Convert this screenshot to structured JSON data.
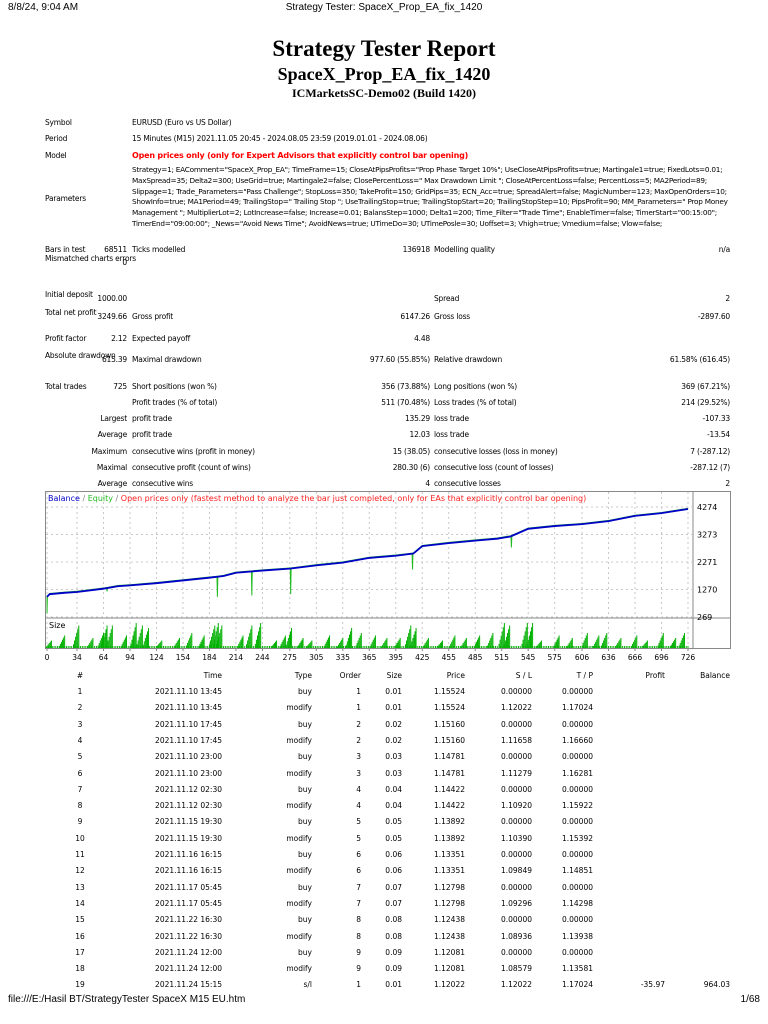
{
  "browser": {
    "datetime": "8/8/24, 9:04 AM",
    "tab_title": "Strategy Tester: SpaceX_Prop_EA_fix_1420",
    "file_path": "file:///E:/Hasil BT/StrategyTester SpaceX M15 EU.htm",
    "page": "1/68"
  },
  "report": {
    "title": "Strategy Tester Report",
    "ea_name": "SpaceX_Prop_EA_fix_1420",
    "server": "ICMarketsSC-Demo02 (Build 1420)"
  },
  "summary": {
    "symbol_label": "Symbol",
    "symbol": "EURUSD (Euro vs US Dollar)",
    "period_label": "Period",
    "period": "15 Minutes (M15) 2021.11.05 20:45 - 2024.08.05 23:59 (2019.01.01 - 2024.08.06)",
    "model_label": "Model",
    "model": "Open prices only (only for Expert Advisors that explicitly control bar opening)",
    "parameters_label": "Parameters",
    "parameters": "Strategy=1; EAComment=\"SpaceX_Prop_EA\"; TimeFrame=15; CloseAtPipsProfits=\"Prop Phase Target 10%\"; UseCloseAtPipsProfits=true; Martingale1=true; FixedLots=0.01; MaxSpread=35; Delta2=300; UseGrid=true; Martingale2=false; ClosePercentLoss=\" Max Drawdown Limit \"; CloseAtPercentLoss=false; PercentLoss=5; MA2Period=89; Slippage=1; Trade_Parameters=\"Pass Challenge\"; StopLoss=350; TakeProfit=150; GridPips=35; ECN_Acc=true; SpreadAlert=false; MagicNumber=123; MaxOpenOrders=10; ShowInfo=true; MA1Period=49; TrailingStop=\" Trailing Stop \"; UseTrailingStop=true; TrailingStopStart=20; TrailingStopStep=10; PipsProfit=90; MM_Parameters=\" Prop Money Management \"; MultiplierLot=2; LotIncrease=false; Increase=0.01; BalansStep=1000; Delta1=200; Time_Filter=\"Trade Time\"; EnableTimer=false; TimerStart=\"00:15:00\"; TimerEnd=\"09:00:00\"; _News=\"Avoid News Time\"; AvoidNews=true; UTimeDo=30; UTimePosle=30; Uoffset=3; Vhigh=true; Vmedium=false; Vlow=false;",
    "rows": [
      {
        "l1": "Bars in test",
        "v1": "68511",
        "l2": "Ticks modelled",
        "v2": "136918",
        "l3": "Modelling quality",
        "v3": "n/a"
      },
      {
        "l1": "Mismatched charts errors",
        "v1": "0",
        "l2": "",
        "v2": "",
        "l3": "",
        "v3": ""
      },
      {
        "l1": "Initial deposit",
        "v1": "1000.00",
        "l2": "",
        "v2": "",
        "l3": "Spread",
        "v3": "2"
      },
      {
        "l1": "Total net profit",
        "v1": "3249.66",
        "l2": "Gross profit",
        "v2": "6147.26",
        "l3": "Gross loss",
        "v3": "-2897.60"
      },
      {
        "l1": "Profit factor",
        "v1": "2.12",
        "l2": "Expected payoff",
        "v2": "4.48",
        "l3": "",
        "v3": ""
      },
      {
        "l1": "Absolute drawdown",
        "v1": "615.39",
        "l2": "Maximal drawdown",
        "v2": "977.60 (55.85%)",
        "l3": "Relative drawdown",
        "v3": "61.58% (616.45)"
      },
      {
        "l1": "Total trades",
        "v1": "725",
        "l2": "Short positions (won %)",
        "v2": "356 (73.88%)",
        "l3": "Long positions (won %)",
        "v3": "369 (67.21%)"
      },
      {
        "l1": "",
        "v1": "",
        "l2": "Profit trades (% of total)",
        "v2": "511 (70.48%)",
        "l3": "Loss trades (% of total)",
        "v3": "214 (29.52%)"
      },
      {
        "l1": "",
        "v1": "Largest",
        "l2": "profit trade",
        "v2": "135.29",
        "l3": "loss trade",
        "v3": "-107.33"
      },
      {
        "l1": "",
        "v1": "Average",
        "l2": "profit trade",
        "v2": "12.03",
        "l3": "loss trade",
        "v3": "-13.54"
      },
      {
        "l1": "",
        "v1": "Maximum",
        "l2": "consecutive wins (profit in money)",
        "v2": "15 (38.05)",
        "l3": "consecutive losses (loss in money)",
        "v3": "7 (-287.12)"
      },
      {
        "l1": "",
        "v1": "Maximal",
        "l2": "consecutive profit (count of wins)",
        "v2": "280.30 (6)",
        "l3": "consecutive loss (count of losses)",
        "v3": "-287.12 (7)"
      },
      {
        "l1": "",
        "v1": "Average",
        "l2": "consecutive wins",
        "v2": "4",
        "l3": "consecutive losses",
        "v3": "2"
      }
    ]
  },
  "chart_data": {
    "type": "line",
    "legend": {
      "balance": "Balance",
      "sep1": " / ",
      "equity": "Equity",
      "sep2": " / ",
      "model": "Open prices only (fastest method to analyze the bar just completed, only for EAs that explicitly control bar opening)"
    },
    "size_label": "Size",
    "colors": {
      "balance": "#0000c8",
      "equity": "#22bb22",
      "model": "#ff2020",
      "size": "#00b000",
      "grid": "#c8c8c8"
    },
    "x_ticks": [
      "0",
      "34",
      "64",
      "94",
      "124",
      "154",
      "184",
      "214",
      "244",
      "275",
      "305",
      "335",
      "365",
      "395",
      "425",
      "455",
      "485",
      "515",
      "545",
      "575",
      "606",
      "636",
      "666",
      "696",
      "726"
    ],
    "y_ticks": [
      "4274",
      "3273",
      "2271",
      "1270",
      "269"
    ],
    "xlim": [
      0,
      726
    ],
    "ylim": [
      269,
      4274
    ],
    "balance": [
      [
        0,
        1000
      ],
      [
        3,
        1100
      ],
      [
        20,
        1150
      ],
      [
        34,
        1180
      ],
      [
        64,
        1300
      ],
      [
        80,
        1390
      ],
      [
        94,
        1420
      ],
      [
        124,
        1500
      ],
      [
        154,
        1600
      ],
      [
        184,
        1700
      ],
      [
        200,
        1760
      ],
      [
        214,
        1880
      ],
      [
        244,
        1960
      ],
      [
        275,
        2030
      ],
      [
        305,
        2150
      ],
      [
        335,
        2250
      ],
      [
        365,
        2420
      ],
      [
        395,
        2500
      ],
      [
        415,
        2580
      ],
      [
        425,
        2850
      ],
      [
        455,
        2960
      ],
      [
        485,
        3050
      ],
      [
        510,
        3120
      ],
      [
        525,
        3200
      ],
      [
        545,
        3480
      ],
      [
        575,
        3580
      ],
      [
        606,
        3650
      ],
      [
        636,
        3760
      ],
      [
        666,
        3950
      ],
      [
        696,
        4050
      ],
      [
        726,
        4200
      ]
    ],
    "equity_dips": [
      [
        0,
        400
      ],
      [
        68,
        1200
      ],
      [
        193,
        1000
      ],
      [
        232,
        1050
      ],
      [
        276,
        1100
      ],
      [
        414,
        2000
      ],
      [
        526,
        2800
      ]
    ],
    "size_spikes": [
      [
        5,
        0.3
      ],
      [
        20,
        0.5
      ],
      [
        36,
        0.9
      ],
      [
        52,
        0.4
      ],
      [
        64,
        0.6
      ],
      [
        68,
        0.9
      ],
      [
        74,
        0.9
      ],
      [
        90,
        0.5
      ],
      [
        101,
        1
      ],
      [
        108,
        0.9
      ],
      [
        115,
        0.8
      ],
      [
        130,
        0.3
      ],
      [
        150,
        0.4
      ],
      [
        164,
        0.6
      ],
      [
        178,
        0.5
      ],
      [
        190,
        0.9
      ],
      [
        194,
        1
      ],
      [
        198,
        0.9
      ],
      [
        222,
        0.5
      ],
      [
        232,
        0.9
      ],
      [
        242,
        1
      ],
      [
        260,
        0.3
      ],
      [
        270,
        0.5
      ],
      [
        277,
        0.8
      ],
      [
        290,
        0.4
      ],
      [
        300,
        0.3
      ],
      [
        320,
        0.5
      ],
      [
        335,
        0.4
      ],
      [
        345,
        0.8
      ],
      [
        356,
        0.6
      ],
      [
        372,
        0.5
      ],
      [
        385,
        0.4
      ],
      [
        400,
        0.4
      ],
      [
        412,
        0.9
      ],
      [
        418,
        0.8
      ],
      [
        432,
        0.4
      ],
      [
        448,
        0.3
      ],
      [
        462,
        0.5
      ],
      [
        475,
        0.4
      ],
      [
        490,
        0.5
      ],
      [
        505,
        0.6
      ],
      [
        518,
        1
      ],
      [
        524,
        0.9
      ],
      [
        544,
        1
      ],
      [
        550,
        1
      ],
      [
        560,
        0.3
      ],
      [
        580,
        0.5
      ],
      [
        595,
        0.4
      ],
      [
        612,
        0.6
      ],
      [
        625,
        0.5
      ],
      [
        634,
        0.6
      ],
      [
        650,
        0.4
      ],
      [
        668,
        0.5
      ],
      [
        680,
        0.3
      ],
      [
        698,
        0.6
      ],
      [
        712,
        0.4
      ],
      [
        722,
        0.6
      ]
    ]
  },
  "trades": {
    "headers": [
      "#",
      "Time",
      "Type",
      "Order",
      "Size",
      "Price",
      "S / L",
      "T / P",
      "Profit",
      "Balance"
    ],
    "rows": [
      [
        "1",
        "2021.11.10 13:45",
        "buy",
        "1",
        "0.01",
        "1.15524",
        "0.00000",
        "0.00000",
        "",
        ""
      ],
      [
        "2",
        "2021.11.10 13:45",
        "modify",
        "1",
        "0.01",
        "1.15524",
        "1.12022",
        "1.17024",
        "",
        ""
      ],
      [
        "3",
        "2021.11.10 17:45",
        "buy",
        "2",
        "0.02",
        "1.15160",
        "0.00000",
        "0.00000",
        "",
        ""
      ],
      [
        "4",
        "2021.11.10 17:45",
        "modify",
        "2",
        "0.02",
        "1.15160",
        "1.11658",
        "1.16660",
        "",
        ""
      ],
      [
        "5",
        "2021.11.10 23:00",
        "buy",
        "3",
        "0.03",
        "1.14781",
        "0.00000",
        "0.00000",
        "",
        ""
      ],
      [
        "6",
        "2021.11.10 23:00",
        "modify",
        "3",
        "0.03",
        "1.14781",
        "1.11279",
        "1.16281",
        "",
        ""
      ],
      [
        "7",
        "2021.11.12 02:30",
        "buy",
        "4",
        "0.04",
        "1.14422",
        "0.00000",
        "0.00000",
        "",
        ""
      ],
      [
        "8",
        "2021.11.12 02:30",
        "modify",
        "4",
        "0.04",
        "1.14422",
        "1.10920",
        "1.15922",
        "",
        ""
      ],
      [
        "9",
        "2021.11.15 19:30",
        "buy",
        "5",
        "0.05",
        "1.13892",
        "0.00000",
        "0.00000",
        "",
        ""
      ],
      [
        "10",
        "2021.11.15 19:30",
        "modify",
        "5",
        "0.05",
        "1.13892",
        "1.10390",
        "1.15392",
        "",
        ""
      ],
      [
        "11",
        "2021.11.16 16:15",
        "buy",
        "6",
        "0.06",
        "1.13351",
        "0.00000",
        "0.00000",
        "",
        ""
      ],
      [
        "12",
        "2021.11.16 16:15",
        "modify",
        "6",
        "0.06",
        "1.13351",
        "1.09849",
        "1.14851",
        "",
        ""
      ],
      [
        "13",
        "2021.11.17 05:45",
        "buy",
        "7",
        "0.07",
        "1.12798",
        "0.00000",
        "0.00000",
        "",
        ""
      ],
      [
        "14",
        "2021.11.17 05:45",
        "modify",
        "7",
        "0.07",
        "1.12798",
        "1.09296",
        "1.14298",
        "",
        ""
      ],
      [
        "15",
        "2021.11.22 16:30",
        "buy",
        "8",
        "0.08",
        "1.12438",
        "0.00000",
        "0.00000",
        "",
        ""
      ],
      [
        "16",
        "2021.11.22 16:30",
        "modify",
        "8",
        "0.08",
        "1.12438",
        "1.08936",
        "1.13938",
        "",
        ""
      ],
      [
        "17",
        "2021.11.24 12:00",
        "buy",
        "9",
        "0.09",
        "1.12081",
        "0.00000",
        "0.00000",
        "",
        ""
      ],
      [
        "18",
        "2021.11.24 12:00",
        "modify",
        "9",
        "0.09",
        "1.12081",
        "1.08579",
        "1.13581",
        "",
        ""
      ],
      [
        "19",
        "2021.11.24 15:15",
        "s/l",
        "1",
        "0.01",
        "1.12022",
        "1.12022",
        "1.17024",
        "-35.97",
        "964.03"
      ]
    ]
  }
}
